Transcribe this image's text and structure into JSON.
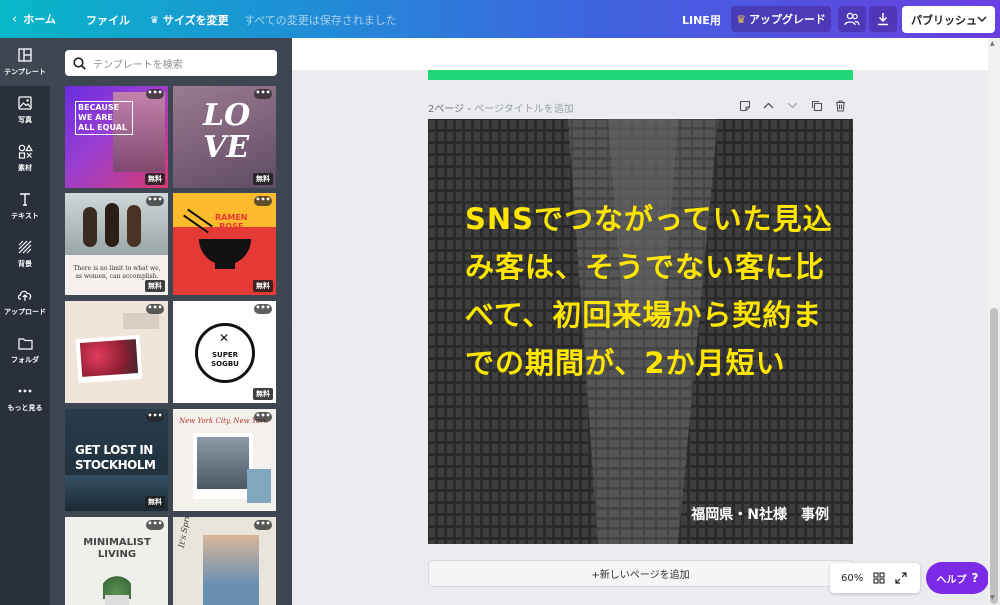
{
  "topbar": {
    "home_label": "ホーム",
    "file_label": "ファイル",
    "resize_label": "サイズを変更",
    "saved_status": "すべての変更は保存されました",
    "line_label": "LINE用",
    "upgrade_label": "アップグレード",
    "publish_label": "パブリッシュ"
  },
  "rail": {
    "items": [
      {
        "label": "テンプレート",
        "icon": "template-icon"
      },
      {
        "label": "写真",
        "icon": "photo-icon"
      },
      {
        "label": "素材",
        "icon": "elements-icon"
      },
      {
        "label": "テキスト",
        "icon": "text-icon"
      },
      {
        "label": "背景",
        "icon": "background-icon"
      },
      {
        "label": "アップロード",
        "icon": "upload-icon"
      },
      {
        "label": "フォルダ",
        "icon": "folder-icon"
      },
      {
        "label": "もっと見る",
        "icon": "more-icon"
      }
    ]
  },
  "panel": {
    "search_placeholder": "テンプレートを検索",
    "free_badge": "無料",
    "more_dots": "•••",
    "templates": [
      {
        "lines": [
          "BECAUSE",
          "WE ARE",
          "ALL EQUAL"
        ]
      },
      {
        "lines": [
          "LO",
          "VE"
        ]
      },
      {
        "lines": [
          "There is no limit to what we,",
          "as women, can accomplish."
        ]
      },
      {
        "lines": [
          "RAMEN",
          "ROSE"
        ]
      },
      {
        "lines": []
      },
      {
        "lines": [
          "SUPER",
          "SOGBU"
        ]
      },
      {
        "lines": [
          "GET LOST IN",
          "STOCKHOLM"
        ]
      },
      {
        "lines": [
          "New York City, New York"
        ]
      },
      {
        "lines": [
          "MINIMALIST",
          "LIVING"
        ]
      },
      {
        "lines": [
          "It's Spring!"
        ]
      }
    ]
  },
  "editor": {
    "page_label": "2ページ - ",
    "page_title_placeholder": "ページタイトルを追加",
    "headline": "SNSでつながっていた見込み客は、そうでない客に比べて、初回来場から契約までの期間が、2か月短い",
    "caption": "福岡県・N社様　事例",
    "add_page_label": "+新しいページを追加",
    "zoom": "60%",
    "help_label": "ヘルプ",
    "help_mark": "?"
  },
  "colors": {
    "headline": "#ffe600",
    "accent_green": "#22d67a",
    "help_purple": "#7d2ae8"
  }
}
